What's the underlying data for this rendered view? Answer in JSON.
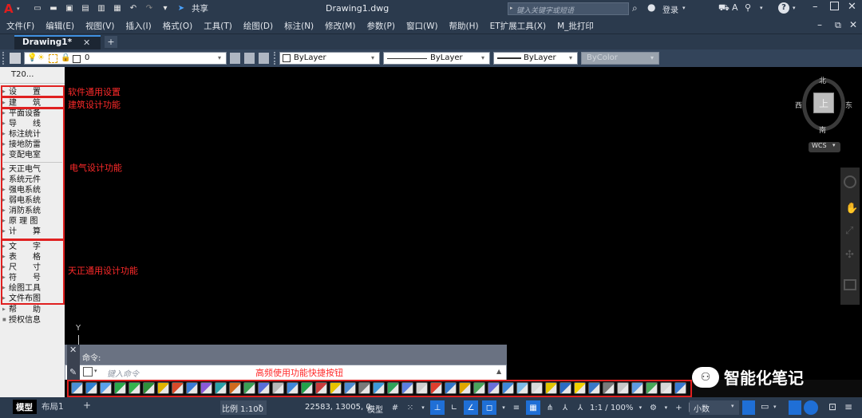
{
  "titlebar": {
    "doc_title": "Drawing1.dwg",
    "share_label": "共享",
    "search_placeholder": "键入关键字或短语",
    "login_label": "登录"
  },
  "menu": {
    "items": [
      "文件(F)",
      "编辑(E)",
      "视图(V)",
      "插入(I)",
      "格式(O)",
      "工具(T)",
      "绘图(D)",
      "标注(N)",
      "修改(M)",
      "参数(P)",
      "窗口(W)",
      "帮助(H)",
      "ET扩展工具(X)",
      "M_批打印"
    ]
  },
  "tabs": {
    "active": "Drawing1*",
    "close": "✕",
    "add": "+"
  },
  "layer": {
    "current_layer": "0",
    "color": "ByLayer",
    "linetype": "ByLayer",
    "lineweight": "ByLayer",
    "plotstyle": "ByColor"
  },
  "left_panel": {
    "header": "T20...",
    "groups": {
      "settings": [
        "设　　置"
      ],
      "arch": [
        "建　　筑"
      ],
      "electrical_a": [
        "平面设备",
        "导　　线",
        "标注统计",
        "接地防雷",
        "变配电室"
      ],
      "electrical_b": [
        "天正电气",
        "系统元件",
        "强电系统",
        "弱电系统",
        "消防系统",
        "原 理 图",
        "计　　算"
      ],
      "general": [
        "文　　字",
        "表　　格",
        "尺　　寸",
        "符　　号",
        "绘图工具",
        "文件布图"
      ],
      "bottom": [
        "帮　　助",
        "授权信息"
      ]
    }
  },
  "annotations": {
    "settings": "软件通用设置",
    "arch": "建筑设计功能",
    "electrical": "电气设计功能",
    "general": "天正通用设计功能",
    "shortcut": "高频使用功能快捷按钮"
  },
  "compass": {
    "north": "北",
    "south": "南",
    "east": "东",
    "west": "西",
    "top": "上",
    "wcs": "WCS"
  },
  "ucs": {
    "y_label": "Y"
  },
  "command": {
    "label": "命令:",
    "placeholder": "键入命令"
  },
  "layout_tabs": {
    "model": "模型",
    "layout1": "布局1",
    "add": "+"
  },
  "status": {
    "scale": "比例 1:100",
    "coords": "22583, 13005, 0",
    "model": "模型",
    "anno_scale": "1:1 / 100%",
    "units": "小数"
  },
  "watermark": {
    "text": "智能化笔记"
  },
  "colors": {
    "accent": "#1f6fd6",
    "annotation_red": "#ff2a2a",
    "box_red": "#e02020",
    "panel_bg": "#2b3a4d"
  }
}
